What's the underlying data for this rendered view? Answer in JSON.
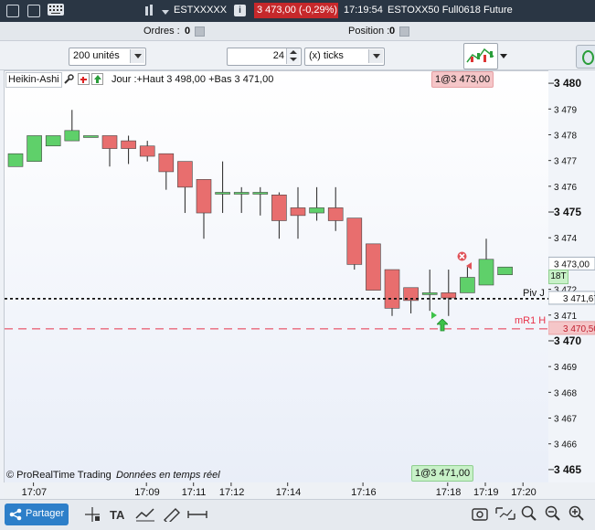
{
  "titlebar": {
    "instrument": "ESTXXXXX",
    "price_change": "3 473,00 (-0,29%)",
    "time": "17:19:54",
    "contract": "ESTOXX50 Full0618 Future",
    "info_label": "i"
  },
  "infobar": {
    "orders_label": "Ordres :",
    "orders_value": "0",
    "position_label": "Position :",
    "position_value": "0"
  },
  "toolbar": {
    "units_value": "200 unités",
    "ticks_count": "24",
    "ticks_unit": "(x) ticks"
  },
  "chart": {
    "style_label": "Heikin-Ashi",
    "day_info": "Jour :+Haut 3 498,00 +Bas 3 471,00",
    "top_order": "1@3 473,00",
    "bottom_order": "1@3 471,00",
    "copyright": "© ProRealTime Trading",
    "realtime": "Données en temps réel",
    "piv_label": "Piv J",
    "mr1_label": "mR1 H",
    "bars_label": "18T",
    "colors": {
      "up": "#5fd06a",
      "down": "#e86e6e",
      "piv": "#111111",
      "mr1": "#e8324a"
    }
  },
  "chart_data": {
    "type": "candlestick",
    "ylim": [
      3464.5,
      3480.5
    ],
    "y_ticks": [
      3480,
      3479,
      3478,
      3477,
      3476,
      3475,
      3474,
      3473,
      3472,
      3471,
      3470,
      3469,
      3468,
      3467,
      3466,
      3465
    ],
    "y_tick_labels": [
      "3 480",
      "3 479",
      "3 478",
      "3 477",
      "3 476",
      "3 475",
      "3 474",
      "3 473,00",
      "3 472",
      "3 471",
      "3 470",
      "3 469",
      "3 468",
      "3 467",
      "3 466",
      "3 465"
    ],
    "y_major": [
      3480,
      3475,
      3470,
      3465
    ],
    "x_labels": [
      "17:07",
      "17:09",
      "17:11",
      "17:12",
      "17:14",
      "17:16",
      "17:18",
      "17:19",
      "17:20"
    ],
    "x_label_positions": [
      1,
      7,
      9.5,
      11.5,
      14.5,
      18.5,
      23,
      25,
      27
    ],
    "piv_value": 3471.67,
    "piv_label_value": "3 471,67",
    "mr1_value": 3470.5,
    "mr1_label_value": "3 470,50",
    "last_value": 3473.0,
    "candles": [
      {
        "o": 3476.8,
        "h": 3477.3,
        "l": 3476.8,
        "c": 3477.3
      },
      {
        "o": 3477.0,
        "h": 3478.0,
        "l": 3477.0,
        "c": 3478.0
      },
      {
        "o": 3477.6,
        "h": 3478.0,
        "l": 3477.6,
        "c": 3478.0
      },
      {
        "o": 3477.8,
        "h": 3479.0,
        "l": 3477.8,
        "c": 3478.2
      },
      {
        "o": 3478.0,
        "h": 3478.0,
        "l": 3478.0,
        "c": 3478.0
      },
      {
        "o": 3478.0,
        "h": 3478.0,
        "l": 3476.8,
        "c": 3477.5
      },
      {
        "o": 3477.8,
        "h": 3478.0,
        "l": 3476.9,
        "c": 3477.5
      },
      {
        "o": 3477.6,
        "h": 3477.8,
        "l": 3477.0,
        "c": 3477.2
      },
      {
        "o": 3477.3,
        "h": 3477.3,
        "l": 3475.9,
        "c": 3476.6
      },
      {
        "o": 3477.0,
        "h": 3477.0,
        "l": 3475.0,
        "c": 3476.0
      },
      {
        "o": 3476.3,
        "h": 3476.3,
        "l": 3474.0,
        "c": 3475.0
      },
      {
        "o": 3475.8,
        "h": 3477.0,
        "l": 3475.0,
        "c": 3475.8
      },
      {
        "o": 3475.8,
        "h": 3476.0,
        "l": 3475.0,
        "c": 3475.8
      },
      {
        "o": 3475.8,
        "h": 3476.0,
        "l": 3474.9,
        "c": 3475.8
      },
      {
        "o": 3475.7,
        "h": 3475.8,
        "l": 3474.0,
        "c": 3474.7
      },
      {
        "o": 3475.2,
        "h": 3476.0,
        "l": 3474.0,
        "c": 3474.9
      },
      {
        "o": 3475.0,
        "h": 3476.0,
        "l": 3474.7,
        "c": 3475.2
      },
      {
        "o": 3475.2,
        "h": 3476.0,
        "l": 3474.3,
        "c": 3474.7
      },
      {
        "o": 3474.8,
        "h": 3474.8,
        "l": 3472.8,
        "c": 3473.0
      },
      {
        "o": 3473.8,
        "h": 3473.8,
        "l": 3472.0,
        "c": 3472.0
      },
      {
        "o": 3472.8,
        "h": 3472.8,
        "l": 3471.0,
        "c": 3471.3
      },
      {
        "o": 3472.1,
        "h": 3472.1,
        "l": 3471.1,
        "c": 3471.6
      },
      {
        "o": 3471.9,
        "h": 3472.8,
        "l": 3471.2,
        "c": 3471.9
      },
      {
        "o": 3471.9,
        "h": 3472.8,
        "l": 3471.0,
        "c": 3471.7
      },
      {
        "o": 3471.9,
        "h": 3472.9,
        "l": 3471.9,
        "c": 3472.5
      },
      {
        "o": 3472.2,
        "h": 3474.0,
        "l": 3472.2,
        "c": 3473.2
      },
      {
        "o": 3472.6,
        "h": 3472.9,
        "l": 3472.6,
        "c": 3472.9
      }
    ]
  },
  "bottombar": {
    "share_label": "Partager"
  }
}
